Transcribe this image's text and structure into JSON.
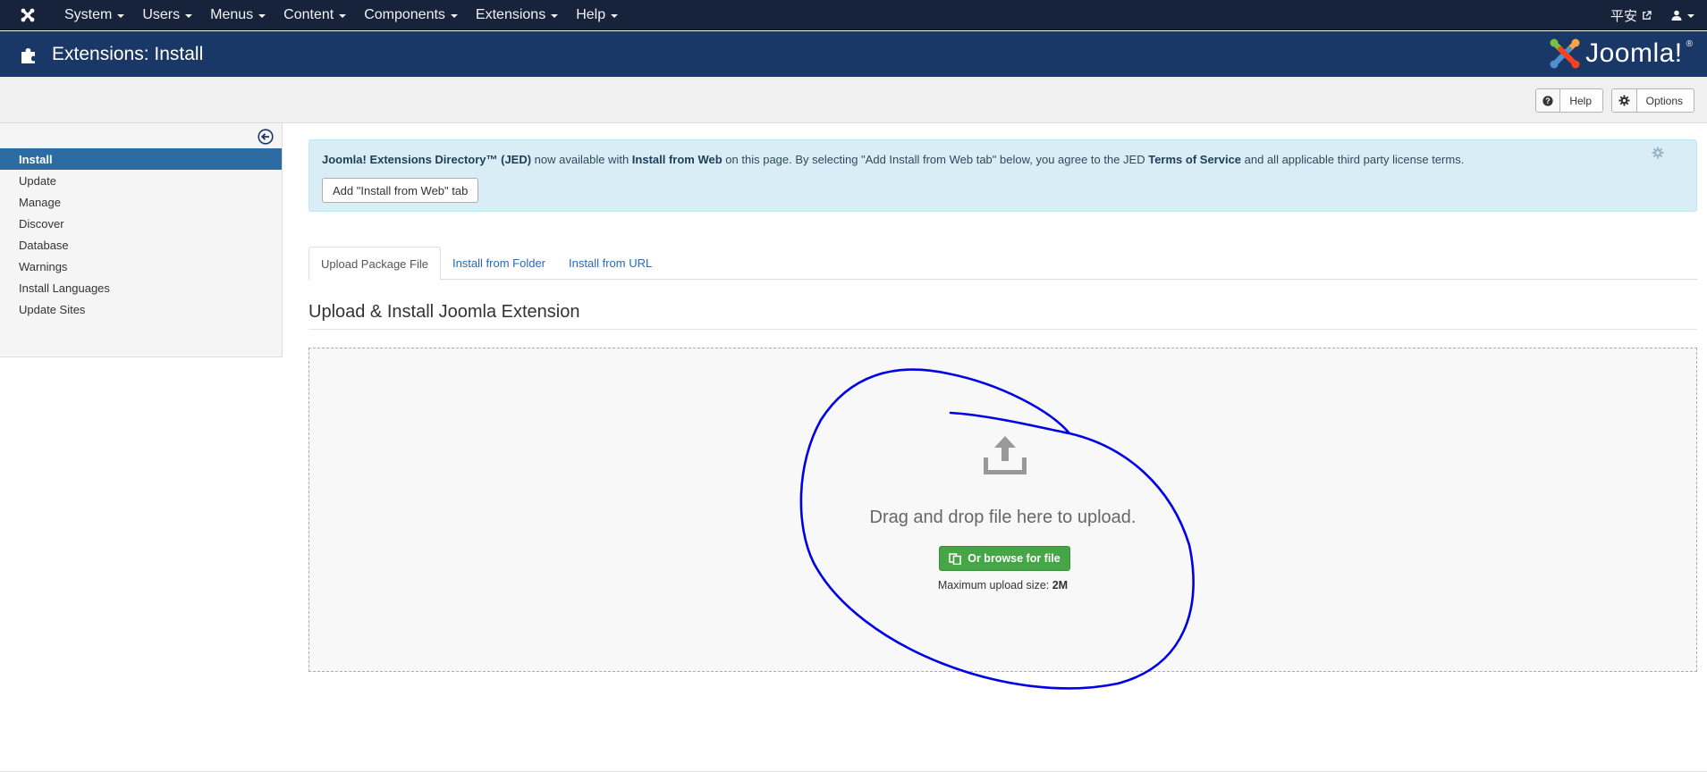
{
  "navbar": {
    "menu": [
      "System",
      "Users",
      "Menus",
      "Content",
      "Components",
      "Extensions",
      "Help"
    ],
    "site_label": "平安",
    "icons": {
      "logo": "joomla-icon",
      "external": "external-link-icon",
      "user": "user-icon"
    }
  },
  "header": {
    "title": "Extensions: Install",
    "brand": "Joomla!",
    "brand_mark": "®"
  },
  "toolbar": {
    "help_label": "Help",
    "options_label": "Options"
  },
  "sidebar": {
    "items": [
      {
        "label": "Install",
        "active": true
      },
      {
        "label": "Update"
      },
      {
        "label": "Manage"
      },
      {
        "label": "Discover"
      },
      {
        "label": "Database"
      },
      {
        "label": "Warnings"
      },
      {
        "label": "Install Languages"
      },
      {
        "label": "Update Sites"
      }
    ]
  },
  "alert": {
    "part1": "Joomla! Extensions Directory™ (JED)",
    "part2": " now available with ",
    "part3": "Install from Web",
    "part4": " on this page. By selecting \"Add Install from Web tab\" below, you agree to the JED ",
    "part5": "Terms of Service",
    "part6": " and all applicable third party license terms.",
    "button_label": "Add \"Install from Web\" tab"
  },
  "tabs": [
    "Upload Package File",
    "Install from Folder",
    "Install from URL"
  ],
  "upload": {
    "title": "Upload & Install Joomla Extension",
    "drop_message": "Drag and drop file here to upload.",
    "browse_label": "Or browse for file",
    "max_label": "Maximum upload size: ",
    "max_value": "2M"
  },
  "colors": {
    "navbar": "#17223b",
    "header": "#1a3867",
    "active_item": "#2d6ca2",
    "browse": "#46a546",
    "annotation": "#0000e6"
  }
}
